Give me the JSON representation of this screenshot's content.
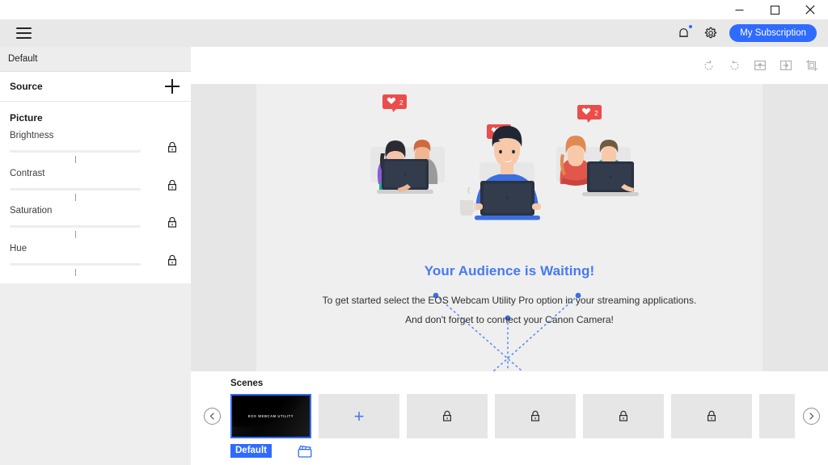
{
  "window": {
    "minimize_label": "Minimize",
    "maximize_label": "Maximize",
    "close_label": "Close"
  },
  "header": {
    "menu_label": "Menu",
    "bell_label": "Notifications",
    "settings_label": "Settings",
    "subscription_label": "My Subscription",
    "accent_color": "#2f6bff",
    "background_color": "#e8e8e8"
  },
  "sidebar": {
    "preset_name": "Default",
    "source": {
      "title": "Source",
      "add_label": "+"
    },
    "picture": {
      "title": "Picture",
      "sliders": [
        {
          "label": "Brightness",
          "value": 50,
          "locked": true
        },
        {
          "label": "Contrast",
          "value": 50,
          "locked": true
        },
        {
          "label": "Saturation",
          "value": 50,
          "locked": true
        },
        {
          "label": "Hue",
          "value": 50,
          "locked": true
        }
      ]
    }
  },
  "preview": {
    "toolbar": [
      {
        "name": "rotate-left-icon",
        "label": "Rotate Left"
      },
      {
        "name": "rotate-right-icon",
        "label": "Rotate Right"
      },
      {
        "name": "flip-vertical-icon",
        "label": "Flip Vertical"
      },
      {
        "name": "flip-horizontal-icon",
        "label": "Flip Horizontal"
      },
      {
        "name": "crop-icon",
        "label": "Crop"
      }
    ],
    "headline": "Your Audience is Waiting!",
    "subline_1": "To get started select the EOS Webcam Utility Pro option in your streaming applications.",
    "subline_2": "And don't forget to connect your Canon Camera!",
    "headline_color": "#4679f5",
    "stage_background": "#e6e6e6",
    "stage_center_background": "#efefef",
    "illustration": {
      "name": "audience-waiting-illustration",
      "badges": [
        "2",
        "1",
        "2"
      ]
    }
  },
  "scenes": {
    "title": "Scenes",
    "prev_label": "Previous",
    "next_label": "Next",
    "active_thumb_text": "EOS WEBCAM UTILITY",
    "default_badge": "Default",
    "record_label": "Scene Settings",
    "tiles": [
      {
        "type": "active",
        "label": "EOS WEBCAM UTILITY"
      },
      {
        "type": "add",
        "label": "+"
      },
      {
        "type": "locked",
        "label": ""
      },
      {
        "type": "locked",
        "label": ""
      },
      {
        "type": "locked",
        "label": ""
      },
      {
        "type": "locked",
        "label": ""
      },
      {
        "type": "partial",
        "label": ""
      }
    ]
  }
}
